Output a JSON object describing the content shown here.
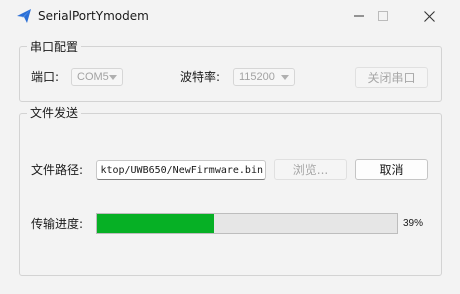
{
  "window": {
    "title": "SerialPortYmodem",
    "icon": "paper-plane-icon"
  },
  "serial_group": {
    "title": "串口配置",
    "port_label": "端口:",
    "port_value": "COM5",
    "baud_label": "波特率:",
    "baud_value": "115200",
    "close_port_label": "关闭串口"
  },
  "file_group": {
    "title": "文件发送",
    "path_label": "文件路径:",
    "path_value": "ktop/UWB650/NewFirmware.bin",
    "browse_label": "浏览...",
    "cancel_label": "取消",
    "progress_label": "传输进度:",
    "progress_value": 0.39,
    "progress_text": "39%"
  },
  "colors": {
    "progress_fill": "#06b025",
    "window_bg": "#f3f3f3"
  }
}
